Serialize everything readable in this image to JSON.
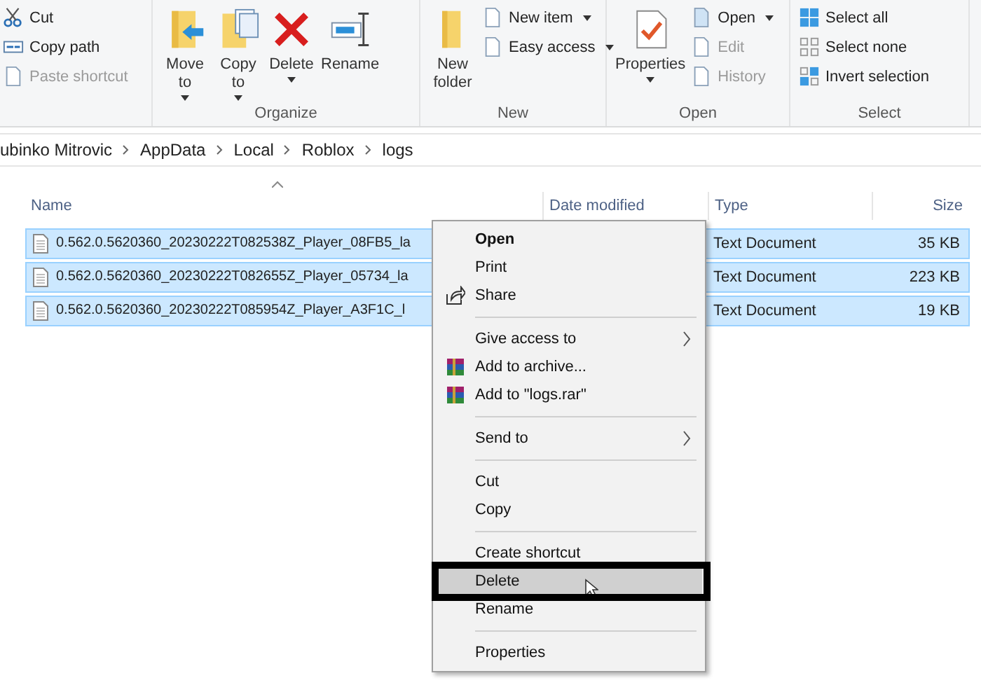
{
  "ribbon": {
    "groups": [
      {
        "small": [
          {
            "label": "Cut",
            "kind": "cut",
            "disabled": false,
            "dropdown": false
          },
          {
            "label": "Copy path",
            "kind": "copypath",
            "disabled": false,
            "dropdown": false
          },
          {
            "label": "Paste shortcut",
            "kind": "paste",
            "disabled": true,
            "dropdown": false
          }
        ]
      },
      {
        "label": "Organize",
        "large": [
          {
            "label": "Move to",
            "kind": "move",
            "dropdown": true
          },
          {
            "label": "Copy to",
            "kind": "copy",
            "dropdown": true
          },
          {
            "label": "Delete",
            "kind": "delete",
            "dropdown": true
          },
          {
            "label": "Rename",
            "kind": "rename",
            "dropdown": false
          }
        ]
      },
      {
        "label": "New",
        "large": [
          {
            "label": "New folder",
            "kind": "newfolder",
            "dropdown": false
          }
        ],
        "small": [
          {
            "label": "New item",
            "kind": "newitem",
            "disabled": false,
            "dropdown": true
          },
          {
            "label": "Easy access",
            "kind": "easy",
            "disabled": false,
            "dropdown": true
          }
        ]
      },
      {
        "label": "Open",
        "large": [
          {
            "label": "Properties",
            "kind": "properties",
            "dropdown": true
          }
        ],
        "small": [
          {
            "label": "Open",
            "kind": "open",
            "disabled": false,
            "dropdown": true
          },
          {
            "label": "Edit",
            "kind": "edit",
            "disabled": true,
            "dropdown": false
          },
          {
            "label": "History",
            "kind": "history",
            "disabled": true,
            "dropdown": false
          }
        ]
      },
      {
        "label": "Select",
        "small": [
          {
            "label": "Select all",
            "kind": "selall",
            "disabled": false,
            "dropdown": false
          },
          {
            "label": "Select none",
            "kind": "selnone",
            "disabled": false,
            "dropdown": false
          },
          {
            "label": "Invert selection",
            "kind": "invert",
            "disabled": false,
            "dropdown": false
          }
        ]
      }
    ]
  },
  "breadcrumb": [
    "ubinko Mitrovic",
    "AppData",
    "Local",
    "Roblox",
    "logs"
  ],
  "table": {
    "columns": [
      "Name",
      "Date modified",
      "Type",
      "Size"
    ],
    "rows": [
      {
        "name": "0.562.0.5620360_20230222T082538Z_Player_08FB5_la",
        "type": "Text Document",
        "size": "35 KB",
        "selected": true
      },
      {
        "name": "0.562.0.5620360_20230222T082655Z_Player_05734_la",
        "type": "Text Document",
        "size": "223 KB",
        "selected": true
      },
      {
        "name": "0.562.0.5620360_20230222T085954Z_Player_A3F1C_l",
        "type": "Text Document",
        "size": "19 KB",
        "selected": true
      }
    ]
  },
  "context_menu": [
    {
      "kind": "item",
      "label": "Open",
      "default": true
    },
    {
      "kind": "item",
      "label": "Print"
    },
    {
      "kind": "share",
      "label": "Share"
    },
    {
      "kind": "separator"
    },
    {
      "kind": "item",
      "label": "Give access to",
      "submenu": true
    },
    {
      "kind": "archive",
      "label": "Add to archive..."
    },
    {
      "kind": "archive",
      "label": "Add to \"logs.rar\""
    },
    {
      "kind": "separator"
    },
    {
      "kind": "item",
      "label": "Send to",
      "submenu": true
    },
    {
      "kind": "separator"
    },
    {
      "kind": "item",
      "label": "Cut"
    },
    {
      "kind": "item",
      "label": "Copy"
    },
    {
      "kind": "separator"
    },
    {
      "kind": "item",
      "label": "Create shortcut"
    },
    {
      "kind": "item",
      "label": "Delete",
      "highlighted": true
    },
    {
      "kind": "item",
      "label": "Rename"
    },
    {
      "kind": "separator"
    },
    {
      "kind": "item",
      "label": "Properties"
    }
  ]
}
